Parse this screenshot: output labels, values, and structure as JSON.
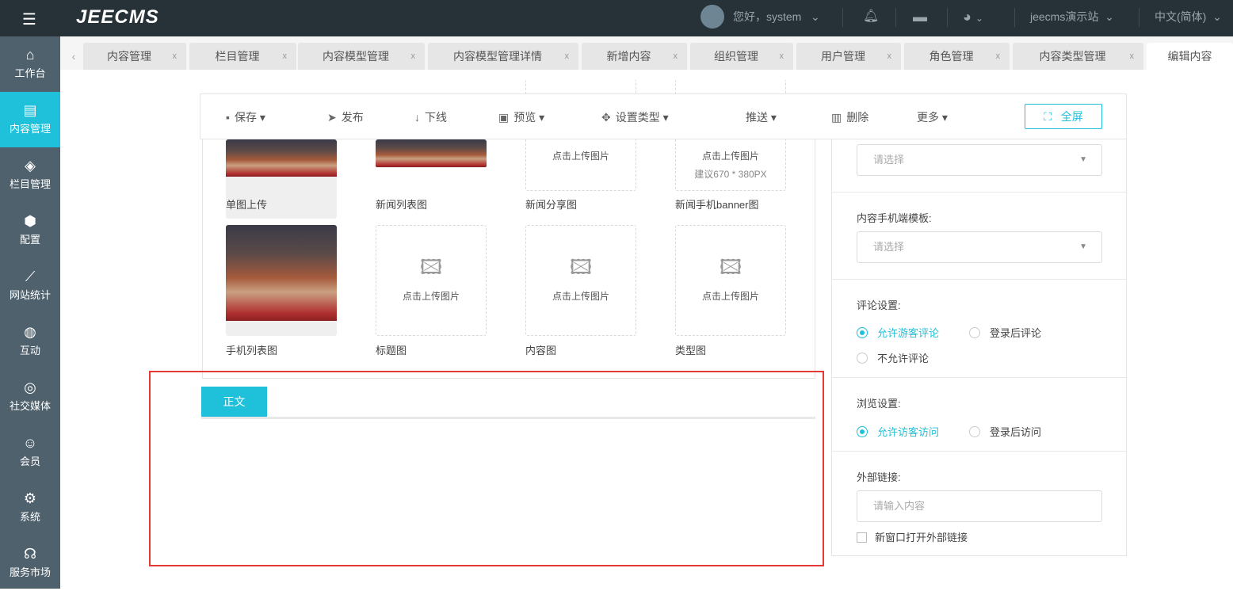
{
  "header": {
    "logo": "JEECMS",
    "greeting": "您好，system",
    "site": "jeecms演示站",
    "language": "中文(简体)"
  },
  "sidebar": [
    {
      "icon": "⌂",
      "label": "工作台"
    },
    {
      "icon": "▤",
      "label": "内容管理"
    },
    {
      "icon": "◈",
      "label": "栏目管理"
    },
    {
      "icon": "⬢",
      "label": "配置"
    },
    {
      "icon": "⟋",
      "label": "网站统计"
    },
    {
      "icon": "◍",
      "label": "互动"
    },
    {
      "icon": "◎",
      "label": "社交媒体"
    },
    {
      "icon": "☺",
      "label": "会员"
    },
    {
      "icon": "⚙",
      "label": "系统"
    },
    {
      "icon": "☊",
      "label": "服务市场"
    }
  ],
  "tabs": [
    "内容管理",
    "栏目管理",
    "内容模型管理",
    "内容模型管理详情",
    "新增内容",
    "组织管理",
    "用户管理",
    "角色管理",
    "内容类型管理",
    "编辑内容"
  ],
  "tab_close": "x",
  "toolbar": {
    "save": "保存",
    "publish": "发布",
    "offline": "下线",
    "preview": "预览",
    "set_type": "设置类型",
    "push": "推送",
    "delete": "删除",
    "more": "更多",
    "fullscreen": "全屏"
  },
  "images": {
    "upload_text": "点击上传图片",
    "suggest": "建议670 * 380PX",
    "labels": [
      "单图上传",
      "新闻列表图",
      "新闻分享图",
      "新闻手机banner图",
      "手机列表图",
      "标题图",
      "内容图",
      "类型图"
    ]
  },
  "body_tab": "正文",
  "right": {
    "placeholder_select": "请选择",
    "mobile_template": "内容手机端模板:",
    "comment": "评论设置:",
    "comment_opts": [
      "允许游客评论",
      "登录后评论",
      "不允许评论"
    ],
    "browse": "浏览设置:",
    "browse_opts": [
      "允许访客访问",
      "登录后访问"
    ],
    "external": "外部链接:",
    "external_placeholder": "请输入内容",
    "new_window": "新窗口打开外部链接"
  }
}
